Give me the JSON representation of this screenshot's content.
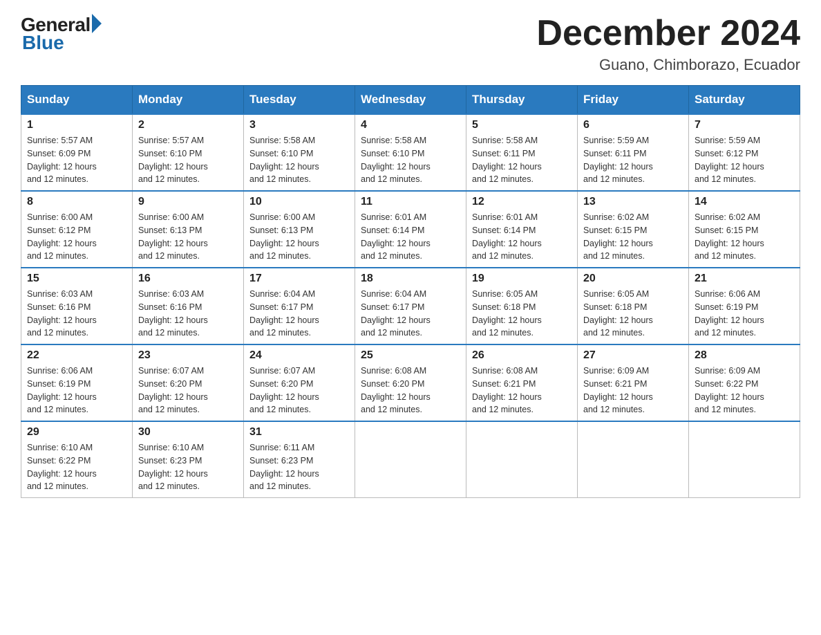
{
  "logo": {
    "text_general": "General",
    "text_blue": "Blue"
  },
  "title": "December 2024",
  "subtitle": "Guano, Chimborazo, Ecuador",
  "days_of_week": [
    "Sunday",
    "Monday",
    "Tuesday",
    "Wednesday",
    "Thursday",
    "Friday",
    "Saturday"
  ],
  "weeks": [
    [
      {
        "day": "1",
        "sunrise": "5:57 AM",
        "sunset": "6:09 PM",
        "daylight": "12 hours and 12 minutes."
      },
      {
        "day": "2",
        "sunrise": "5:57 AM",
        "sunset": "6:10 PM",
        "daylight": "12 hours and 12 minutes."
      },
      {
        "day": "3",
        "sunrise": "5:58 AM",
        "sunset": "6:10 PM",
        "daylight": "12 hours and 12 minutes."
      },
      {
        "day": "4",
        "sunrise": "5:58 AM",
        "sunset": "6:10 PM",
        "daylight": "12 hours and 12 minutes."
      },
      {
        "day": "5",
        "sunrise": "5:58 AM",
        "sunset": "6:11 PM",
        "daylight": "12 hours and 12 minutes."
      },
      {
        "day": "6",
        "sunrise": "5:59 AM",
        "sunset": "6:11 PM",
        "daylight": "12 hours and 12 minutes."
      },
      {
        "day": "7",
        "sunrise": "5:59 AM",
        "sunset": "6:12 PM",
        "daylight": "12 hours and 12 minutes."
      }
    ],
    [
      {
        "day": "8",
        "sunrise": "6:00 AM",
        "sunset": "6:12 PM",
        "daylight": "12 hours and 12 minutes."
      },
      {
        "day": "9",
        "sunrise": "6:00 AM",
        "sunset": "6:13 PM",
        "daylight": "12 hours and 12 minutes."
      },
      {
        "day": "10",
        "sunrise": "6:00 AM",
        "sunset": "6:13 PM",
        "daylight": "12 hours and 12 minutes."
      },
      {
        "day": "11",
        "sunrise": "6:01 AM",
        "sunset": "6:14 PM",
        "daylight": "12 hours and 12 minutes."
      },
      {
        "day": "12",
        "sunrise": "6:01 AM",
        "sunset": "6:14 PM",
        "daylight": "12 hours and 12 minutes."
      },
      {
        "day": "13",
        "sunrise": "6:02 AM",
        "sunset": "6:15 PM",
        "daylight": "12 hours and 12 minutes."
      },
      {
        "day": "14",
        "sunrise": "6:02 AM",
        "sunset": "6:15 PM",
        "daylight": "12 hours and 12 minutes."
      }
    ],
    [
      {
        "day": "15",
        "sunrise": "6:03 AM",
        "sunset": "6:16 PM",
        "daylight": "12 hours and 12 minutes."
      },
      {
        "day": "16",
        "sunrise": "6:03 AM",
        "sunset": "6:16 PM",
        "daylight": "12 hours and 12 minutes."
      },
      {
        "day": "17",
        "sunrise": "6:04 AM",
        "sunset": "6:17 PM",
        "daylight": "12 hours and 12 minutes."
      },
      {
        "day": "18",
        "sunrise": "6:04 AM",
        "sunset": "6:17 PM",
        "daylight": "12 hours and 12 minutes."
      },
      {
        "day": "19",
        "sunrise": "6:05 AM",
        "sunset": "6:18 PM",
        "daylight": "12 hours and 12 minutes."
      },
      {
        "day": "20",
        "sunrise": "6:05 AM",
        "sunset": "6:18 PM",
        "daylight": "12 hours and 12 minutes."
      },
      {
        "day": "21",
        "sunrise": "6:06 AM",
        "sunset": "6:19 PM",
        "daylight": "12 hours and 12 minutes."
      }
    ],
    [
      {
        "day": "22",
        "sunrise": "6:06 AM",
        "sunset": "6:19 PM",
        "daylight": "12 hours and 12 minutes."
      },
      {
        "day": "23",
        "sunrise": "6:07 AM",
        "sunset": "6:20 PM",
        "daylight": "12 hours and 12 minutes."
      },
      {
        "day": "24",
        "sunrise": "6:07 AM",
        "sunset": "6:20 PM",
        "daylight": "12 hours and 12 minutes."
      },
      {
        "day": "25",
        "sunrise": "6:08 AM",
        "sunset": "6:20 PM",
        "daylight": "12 hours and 12 minutes."
      },
      {
        "day": "26",
        "sunrise": "6:08 AM",
        "sunset": "6:21 PM",
        "daylight": "12 hours and 12 minutes."
      },
      {
        "day": "27",
        "sunrise": "6:09 AM",
        "sunset": "6:21 PM",
        "daylight": "12 hours and 12 minutes."
      },
      {
        "day": "28",
        "sunrise": "6:09 AM",
        "sunset": "6:22 PM",
        "daylight": "12 hours and 12 minutes."
      }
    ],
    [
      {
        "day": "29",
        "sunrise": "6:10 AM",
        "sunset": "6:22 PM",
        "daylight": "12 hours and 12 minutes."
      },
      {
        "day": "30",
        "sunrise": "6:10 AM",
        "sunset": "6:23 PM",
        "daylight": "12 hours and 12 minutes."
      },
      {
        "day": "31",
        "sunrise": "6:11 AM",
        "sunset": "6:23 PM",
        "daylight": "12 hours and 12 minutes."
      },
      null,
      null,
      null,
      null
    ]
  ]
}
